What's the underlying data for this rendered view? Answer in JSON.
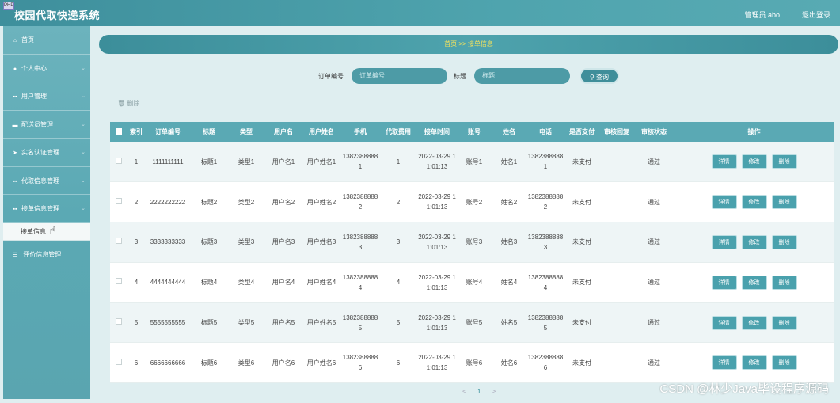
{
  "app": {
    "logo_text": "PHP",
    "title": "校园代取快递系统",
    "admin_label": "管理员 abo",
    "logout_label": "退出登录"
  },
  "sidebar": {
    "items": [
      {
        "icon": "home-icon",
        "glyph": "⌂",
        "label": "首页"
      },
      {
        "icon": "user-icon",
        "glyph": "●",
        "label": "个人中心"
      },
      {
        "icon": "grid-icon",
        "glyph": "▪▪",
        "label": "用户管理"
      },
      {
        "icon": "courier-icon",
        "glyph": "▬",
        "label": "配送员管理"
      },
      {
        "icon": "send-icon",
        "glyph": "➤",
        "label": "实名认证管理"
      },
      {
        "icon": "grid-icon",
        "glyph": "▪▪",
        "label": "代取信息管理"
      },
      {
        "icon": "grid-icon",
        "glyph": "▪▪",
        "label": "接单信息管理"
      }
    ],
    "active_sub": "接单信息",
    "last_item": {
      "icon": "list-icon",
      "glyph": "☰",
      "label": "评价信息管理"
    }
  },
  "breadcrumb": {
    "text": "首页 >> 接单信息"
  },
  "search": {
    "order_label": "订单编号",
    "order_placeholder": "订单编号",
    "title_label": "标题",
    "title_placeholder": "标题",
    "button_label": "查询"
  },
  "delete_label": "删除",
  "table": {
    "headers": [
      "索引",
      "订单编号",
      "标题",
      "类型",
      "用户名",
      "用户姓名",
      "手机",
      "代取费用",
      "接单时间",
      "账号",
      "姓名",
      "电话",
      "是否支付",
      "审核回复",
      "审核状态",
      "操作"
    ],
    "rows": [
      [
        "1",
        "1111111111",
        "标题1",
        "类型1",
        "用户名1",
        "用户姓名1",
        "13823888881",
        "1",
        "2022-03-29 11:01:13",
        "账号1",
        "姓名1",
        "13823888881",
        "未支付",
        "",
        "通过"
      ],
      [
        "2",
        "2222222222",
        "标题2",
        "类型2",
        "用户名2",
        "用户姓名2",
        "13823888882",
        "2",
        "2022-03-29 11:01:13",
        "账号2",
        "姓名2",
        "13823888882",
        "未支付",
        "",
        "通过"
      ],
      [
        "3",
        "3333333333",
        "标题3",
        "类型3",
        "用户名3",
        "用户姓名3",
        "13823888883",
        "3",
        "2022-03-29 11:01:13",
        "账号3",
        "姓名3",
        "13823888883",
        "未支付",
        "",
        "通过"
      ],
      [
        "4",
        "4444444444",
        "标题4",
        "类型4",
        "用户名4",
        "用户姓名4",
        "13823888884",
        "4",
        "2022-03-29 11:01:13",
        "账号4",
        "姓名4",
        "13823888884",
        "未支付",
        "",
        "通过"
      ],
      [
        "5",
        "5555555555",
        "标题5",
        "类型5",
        "用户名5",
        "用户姓名5",
        "13823888885",
        "5",
        "2022-03-29 11:01:13",
        "账号5",
        "姓名5",
        "13823888885",
        "未支付",
        "",
        "通过"
      ],
      [
        "6",
        "6666666666",
        "标题6",
        "类型6",
        "用户名6",
        "用户姓名6",
        "13823888886",
        "6",
        "2022-03-29 11:01:13",
        "账号6",
        "姓名6",
        "13823888886",
        "未支付",
        "",
        "通过"
      ]
    ],
    "actions": [
      "详情",
      "修改",
      "删除"
    ]
  },
  "pager": {
    "prev": "<",
    "current": "1",
    "next": ">"
  },
  "watermark": "CSDN @林少Java毕设程序源码",
  "colors": {
    "header_bar": "#4fa4ae",
    "sidebar": "#5ba9b4",
    "table_head": "#5aa9b4",
    "accent_text": "#f5e35c"
  }
}
